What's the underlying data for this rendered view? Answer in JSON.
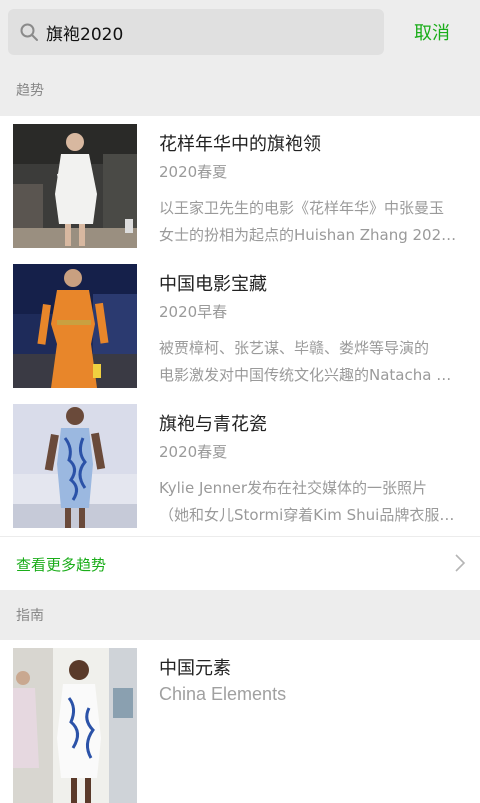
{
  "search": {
    "value": "旗袍2020",
    "cancel_label": "取消"
  },
  "trends": {
    "header": "趋势",
    "items": [
      {
        "title": "花样年华中的旗袍领",
        "season": "2020春夏",
        "desc_line1": "以王家卫先生的电影《花样年华》中张曼玉",
        "desc_line2": "女士的扮相为起点的Huishan Zhang 2020…"
      },
      {
        "title": "中国电影宝藏",
        "season": "2020早春",
        "desc_line1": "被贾樟柯、张艺谋、毕赣、娄烨等导演的",
        "desc_line2": "电影激发对中国传统文化兴趣的Natacha …"
      },
      {
        "title": "旗袍与青花瓷",
        "season": "2020春夏",
        "desc_line1": "Kylie Jenner发布在社交媒体的一张照片",
        "desc_line2": "（她和女儿Stormi穿着Kim Shui品牌衣服…"
      }
    ],
    "more_label": "查看更多趋势"
  },
  "guide": {
    "header": "指南",
    "items": [
      {
        "title": "中国元素",
        "subtitle": "China Elements"
      }
    ]
  },
  "colors": {
    "accent": "#1aad19",
    "background": "#ededed"
  }
}
